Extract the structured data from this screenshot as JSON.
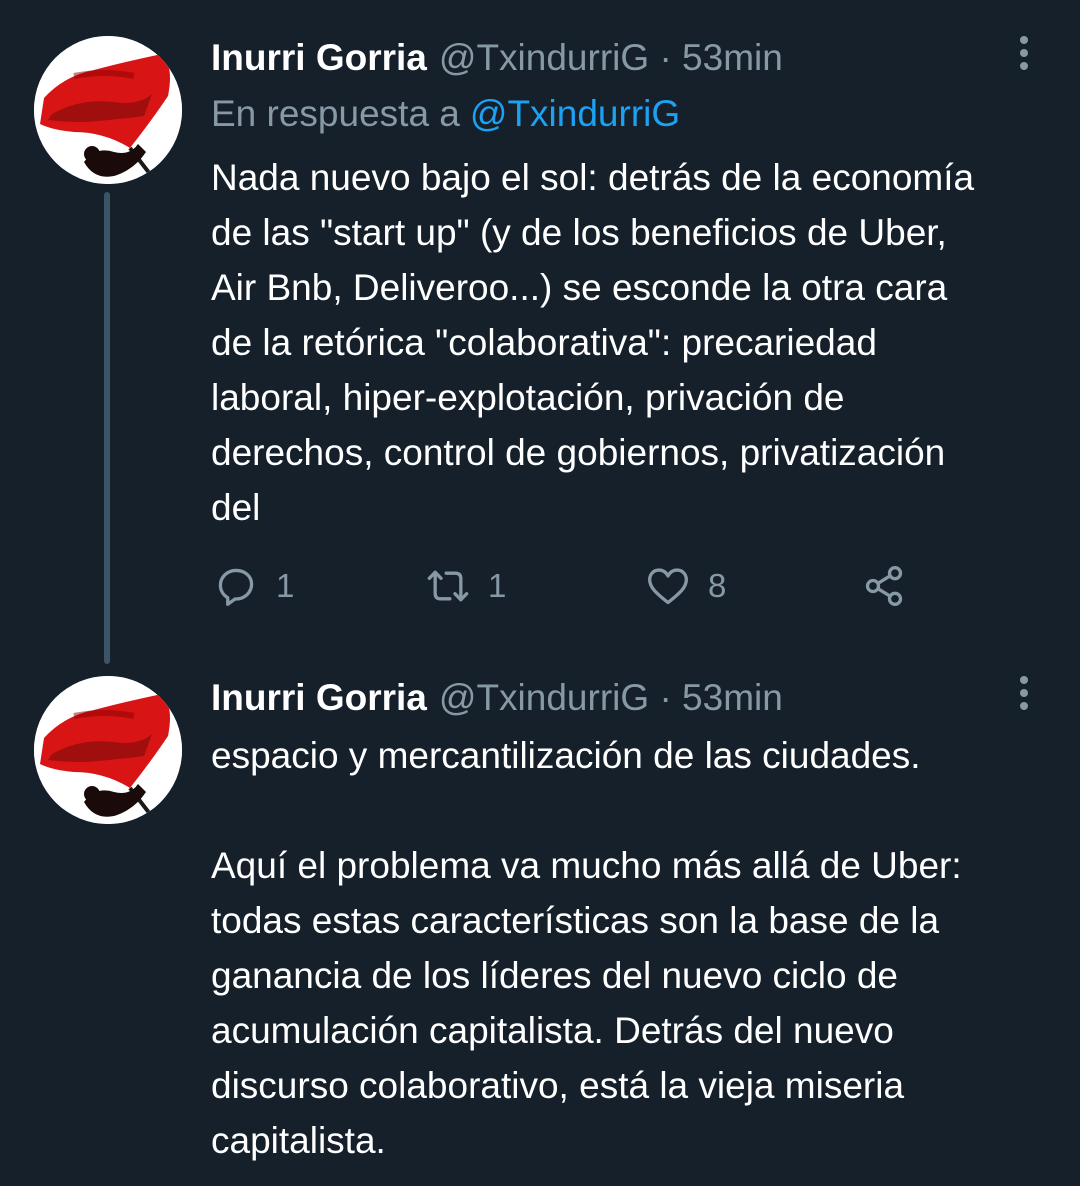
{
  "tweets": [
    {
      "name": "Inurri Gorria",
      "handle": "@TxindurriG",
      "separator": "·",
      "time": "53min",
      "reply_prefix": "En respuesta a",
      "reply_handle": "@TxindurriG",
      "text": "Nada nuevo bajo el sol: detrás de la economía\nde las \"start up\" (y de los beneficios de Uber,\nAir Bnb, Deliveroo...) se esconde la otra cara\nde la retórica \"colaborativa\": precariedad\nlaboral, hiper-explotación, privación de\nderechos, control de gobiernos, privatización\ndel",
      "replies": "1",
      "retweets": "1",
      "likes": "8"
    },
    {
      "name": "Inurri Gorria",
      "handle": "@TxindurriG",
      "separator": "·",
      "time": "53min",
      "text": "espacio y mercantilización de las ciudades.\n\nAquí el problema va mucho más allá de Uber:\ntodas estas características son la base de la\nganancia de los líderes del nuevo ciclo de\nacumulación capitalista. Detrás del nuevo\ndiscurso colaborativo, está la vieja miseria\ncapitalista."
    }
  ],
  "colors": {
    "background": "#15202b",
    "text": "#ffffff",
    "secondary": "#8899a6",
    "link": "#1da1f2",
    "thread_line": "#3d5466"
  },
  "icons": {
    "avatar": "red-flag-avatar",
    "more": "more-options-icon",
    "reply": "reply-icon",
    "retweet": "retweet-icon",
    "like": "heart-icon",
    "share": "share-icon"
  }
}
